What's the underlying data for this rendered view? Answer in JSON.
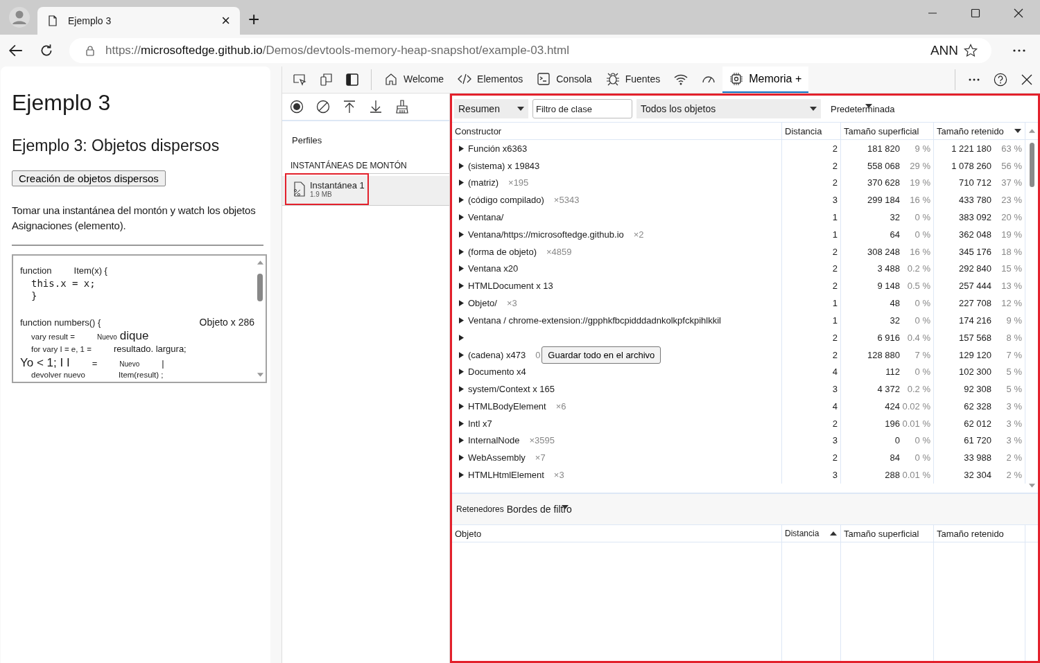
{
  "browser": {
    "tab": {
      "title": "Ejemplo 3",
      "close": "×"
    },
    "new_tab": "+",
    "address": {
      "scheme": "https://",
      "host": "microsoftedge.github.io",
      "path": "/Demos/devtools-memory-heap-snapshot/example-03.html"
    },
    "profile_label": "ANN"
  },
  "page": {
    "title": "Ejemplo 3",
    "subtitle": "Ejemplo 3: Objetos dispersos",
    "button": "Creación de objetos dispersos",
    "paragraph": "Tomar una instantánea del montón y watch los objetos Asignaciones (elemento).",
    "code_lines": [
      {
        "segments": [
          {
            "text": "function",
            "kind": "text"
          },
          {
            "text": "Item(x) {",
            "kind": "text"
          }
        ]
      },
      {
        "segments": [
          {
            "text": "this.x = x;",
            "kind": "mono"
          }
        ]
      },
      {
        "segments": [
          {
            "text": "}",
            "kind": "mono"
          }
        ]
      },
      {
        "segments": [
          {
            "text": "function numbers() {",
            "kind": "text"
          },
          {
            "text": "Objeto x 286",
            "kind": "right"
          }
        ]
      },
      {
        "segments": [
          {
            "text": "vary result =",
            "kind": "small"
          },
          {
            "text": "Nuevo",
            "kind": "tiny"
          },
          {
            "text": "dique",
            "kind": "large"
          }
        ]
      },
      {
        "segments": [
          {
            "text": "for vary I = e, 1 =",
            "kind": "small"
          },
          {
            "text": "resultado. largura;",
            "kind": "text"
          }
        ]
      },
      {
        "segments": [
          {
            "text": "Yo < 1; I I",
            "kind": "large"
          },
          {
            "text": "=",
            "kind": "text"
          },
          {
            "text": "Nuevo",
            "kind": "tiny"
          },
          {
            "text": "|",
            "kind": "text"
          }
        ]
      },
      {
        "segments": [
          {
            "text": "devolver nuevo",
            "kind": "small"
          },
          {
            "text": "Item(result) ;",
            "kind": "small"
          }
        ]
      }
    ]
  },
  "devtools": {
    "tabs": [
      {
        "label": "Welcome",
        "selected": false
      },
      {
        "label": "Elementos",
        "selected": false
      },
      {
        "label": "Consola",
        "selected": false
      },
      {
        "label": "Fuentes",
        "selected": false
      },
      {
        "selected": false
      },
      {
        "selected": false
      },
      {
        "label": "Memoria +",
        "selected": true
      }
    ],
    "sidebar": {
      "heading": "Perfiles",
      "section": "INSTANTÁNEAS DE MONTÓN",
      "snapshots": [
        {
          "name": "Instantánea 1",
          "size": "1.9 MB",
          "selected": true,
          "highlighted": true
        }
      ]
    },
    "main": {
      "highlighted": true,
      "toolbar": {
        "view": "Resumen",
        "filter_placeholder": "Filtro de clase",
        "objects": "Todos los objetos",
        "grouping": "Predeterminada"
      },
      "columns": [
        {
          "label": "Constructor"
        },
        {
          "label": "Distancia"
        },
        {
          "label": "Tamaño superficial"
        },
        {
          "label": "Tamaño retenido",
          "sorted": true,
          "descending": true
        }
      ],
      "rows": [
        {
          "name": "Función x6363",
          "distance": "2",
          "shallow": "181 820",
          "shallow_pct": "9 %",
          "retained": "1 221 180",
          "retained_pct": "63 %"
        },
        {
          "name": "(sistema) x 19843",
          "distance": "2",
          "shallow": "558 068",
          "shallow_pct": "29 %",
          "retained": "1 078 260",
          "retained_pct": "56 %"
        },
        {
          "name": "(matriz)",
          "count": "×195",
          "distance": "2",
          "shallow": "370 628",
          "shallow_pct": "19 %",
          "retained": "710 712",
          "retained_pct": "37 %"
        },
        {
          "name": "(código compilado)",
          "count": "×5343",
          "distance": "3",
          "shallow": "299 184",
          "shallow_pct": "16 %",
          "retained": "433 780",
          "retained_pct": "23 %"
        },
        {
          "name": "Ventana/",
          "distance": "1",
          "shallow": "32",
          "shallow_pct": "0 %",
          "retained": "383 092",
          "retained_pct": "20 %"
        },
        {
          "name": "Ventana/https://microsoftedge.github.io",
          "count": "×2",
          "distance": "1",
          "shallow": "64",
          "shallow_pct": "0 %",
          "retained": "362 048",
          "retained_pct": "19 %"
        },
        {
          "name": "(forma de objeto)",
          "count": "×4859",
          "distance": "2",
          "shallow": "308 248",
          "shallow_pct": "16 %",
          "retained": "345 176",
          "retained_pct": "18 %"
        },
        {
          "name": "Ventana x20",
          "distance": "2",
          "shallow": "3 488",
          "shallow_pct": "0.2 %",
          "retained": "292 840",
          "retained_pct": "15 %"
        },
        {
          "name": "HTMLDocument x 13",
          "distance": "2",
          "shallow": "9 148",
          "shallow_pct": "0.5 %",
          "retained": "257 444",
          "retained_pct": "13 %"
        },
        {
          "name": "Objeto/",
          "count": "×3",
          "distance": "1",
          "shallow": "48",
          "shallow_pct": "0 %",
          "retained": "227 708",
          "retained_pct": "12 %"
        },
        {
          "name": "Ventana / chrome-extension://gpphkfbcpidddadnkolkpfckpihlkkil",
          "distance": "1",
          "shallow": "32",
          "shallow_pct": "0 %",
          "retained": "174 216",
          "retained_pct": "9 %"
        },
        {
          "distance": "2",
          "shallow": "6 916",
          "shallow_pct": "0.4 %",
          "retained": "157 568",
          "retained_pct": "8 %"
        },
        {
          "name": "(cadena) x473",
          "count": "0",
          "button": "Guardar todo en el archivo",
          "distance": "2",
          "shallow": "128 880",
          "shallow_pct": "7 %",
          "retained": "129 120",
          "retained_pct": "7 %"
        },
        {
          "name": "Documento x4",
          "distance": "4",
          "shallow": "112",
          "shallow_pct": "0 %",
          "retained": "102 300",
          "retained_pct": "5 %"
        },
        {
          "name": "system/Context x 165",
          "distance": "3",
          "shallow": "4 372",
          "shallow_pct": "0.2 %",
          "retained": "92 308",
          "retained_pct": "5 %"
        },
        {
          "name": "HTMLBodyElement",
          "count": "×6",
          "distance": "4",
          "shallow": "424",
          "shallow_pct": "0.02 %",
          "retained": "62 328",
          "retained_pct": "3 %"
        },
        {
          "name": "Intl x7",
          "distance": "2",
          "shallow": "196",
          "shallow_pct": "0.01 %",
          "retained": "62 012",
          "retained_pct": "3 %"
        },
        {
          "name": "InternalNode",
          "count": "×3595",
          "distance": "3",
          "shallow": "0",
          "shallow_pct": "0 %",
          "retained": "61 720",
          "retained_pct": "3 %"
        },
        {
          "name": "WebAssembly",
          "count": "×7",
          "distance": "2",
          "shallow": "84",
          "shallow_pct": "0 %",
          "retained": "33 988",
          "retained_pct": "2 %"
        },
        {
          "name": "HTMLHtmlElement",
          "count": "×3",
          "distance": "3",
          "shallow": "288",
          "shallow_pct": "0.01 %",
          "retained": "32 304",
          "retained_pct": "2 %"
        }
      ],
      "retainers": {
        "tabs": [
          {
            "label": "Retenedores"
          },
          {
            "label": "Bordes de filtro"
          }
        ],
        "columns": [
          {
            "label": "Objeto"
          },
          {
            "label": "Distancia",
            "sorted": true,
            "descending": false
          },
          {
            "label": "Tamaño superficial"
          },
          {
            "label": "Tamaño retenido"
          }
        ]
      }
    }
  }
}
